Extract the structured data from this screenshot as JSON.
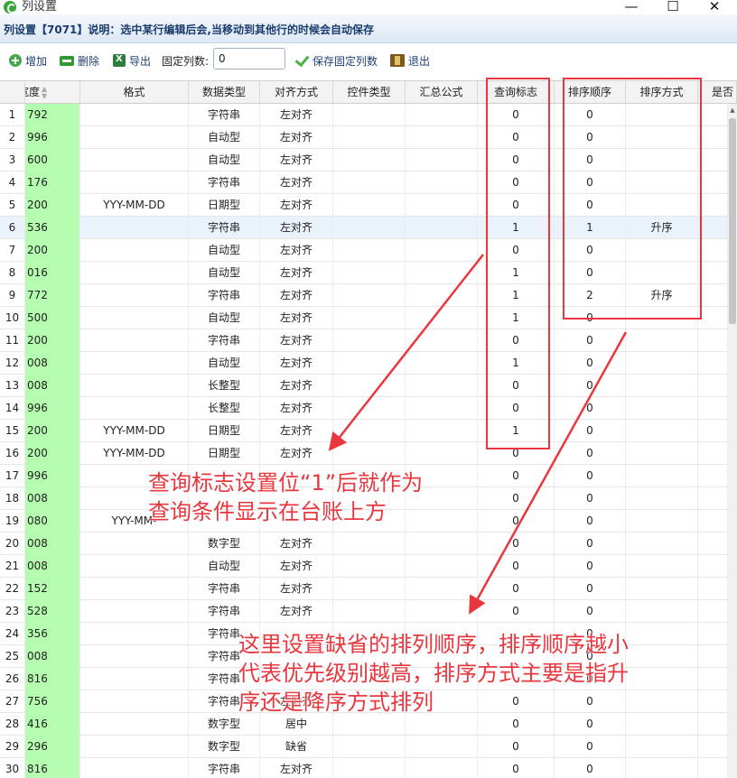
{
  "window": {
    "title": "列设置",
    "controls": [
      "—",
      "☐",
      "✕"
    ]
  },
  "header": {
    "text": "列设置【7071】说明：选中某行编辑后会,当移动到其他行的时候会自动保存"
  },
  "toolbar": {
    "add_label": "增加",
    "delete_label": "删除",
    "export_label": "导出",
    "fixed_cols_label": "固定列数:",
    "fixed_cols_value": "0",
    "save_fixed_label": "保存固定列数",
    "exit_label": "退出"
  },
  "grid": {
    "columns": [
      "宽度",
      "格式",
      "数据类型",
      "对齐方式",
      "控件类型",
      "汇总公式",
      "查询标志",
      "排序顺序",
      "排序方式",
      "是否"
    ],
    "rows": [
      {
        "n": "1",
        "w": "792",
        "fmt": "",
        "type": "字符串",
        "align": "左对齐",
        "q": "0",
        "so": "0",
        "sm": ""
      },
      {
        "n": "2",
        "w": "996",
        "fmt": "",
        "type": "自动型",
        "align": "左对齐",
        "q": "0",
        "so": "0",
        "sm": ""
      },
      {
        "n": "3",
        "w": "600",
        "fmt": "",
        "type": "自动型",
        "align": "左对齐",
        "q": "0",
        "so": "0",
        "sm": ""
      },
      {
        "n": "4",
        "w": "176",
        "fmt": "",
        "type": "字符串",
        "align": "左对齐",
        "q": "0",
        "so": "0",
        "sm": ""
      },
      {
        "n": "5",
        "w": "200",
        "fmt": "YYY-MM-DD",
        "type": "日期型",
        "align": "左对齐",
        "q": "0",
        "so": "0",
        "sm": ""
      },
      {
        "n": "6",
        "w": "536",
        "fmt": "",
        "type": "字符串",
        "align": "左对齐",
        "q": "1",
        "so": "1",
        "sm": "升序"
      },
      {
        "n": "7",
        "w": "200",
        "fmt": "",
        "type": "自动型",
        "align": "左对齐",
        "q": "0",
        "so": "0",
        "sm": ""
      },
      {
        "n": "8",
        "w": "016",
        "fmt": "",
        "type": "自动型",
        "align": "左对齐",
        "q": "1",
        "so": "0",
        "sm": ""
      },
      {
        "n": "9",
        "w": "772",
        "fmt": "",
        "type": "字符串",
        "align": "左对齐",
        "q": "1",
        "so": "2",
        "sm": "升序"
      },
      {
        "n": "10",
        "w": "500",
        "fmt": "",
        "type": "自动型",
        "align": "左对齐",
        "q": "1",
        "so": "0",
        "sm": ""
      },
      {
        "n": "11",
        "w": "200",
        "fmt": "",
        "type": "字符串",
        "align": "左对齐",
        "q": "0",
        "so": "0",
        "sm": ""
      },
      {
        "n": "12",
        "w": "008",
        "fmt": "",
        "type": "自动型",
        "align": "左对齐",
        "q": "1",
        "so": "0",
        "sm": ""
      },
      {
        "n": "13",
        "w": "008",
        "fmt": "",
        "type": "长整型",
        "align": "左对齐",
        "q": "0",
        "so": "0",
        "sm": ""
      },
      {
        "n": "14",
        "w": "996",
        "fmt": "",
        "type": "长整型",
        "align": "左对齐",
        "q": "0",
        "so": "0",
        "sm": ""
      },
      {
        "n": "15",
        "w": "200",
        "fmt": "YYY-MM-DD",
        "type": "日期型",
        "align": "左对齐",
        "q": "1",
        "so": "0",
        "sm": ""
      },
      {
        "n": "16",
        "w": "200",
        "fmt": "YYY-MM-DD",
        "type": "日期型",
        "align": "左对齐",
        "q": "0",
        "so": "0",
        "sm": ""
      },
      {
        "n": "17",
        "w": "996",
        "fmt": "",
        "type": "",
        "align": "",
        "q": "0",
        "so": "0",
        "sm": ""
      },
      {
        "n": "18",
        "w": "008",
        "fmt": "",
        "type": "",
        "align": "",
        "q": "0",
        "so": "0",
        "sm": ""
      },
      {
        "n": "19",
        "w": "080",
        "fmt": "YYY-MM-",
        "type": "",
        "align": "",
        "q": "0",
        "so": "0",
        "sm": ""
      },
      {
        "n": "20",
        "w": "008",
        "fmt": "",
        "type": "数字型",
        "align": "左对齐",
        "q": "0",
        "so": "0",
        "sm": ""
      },
      {
        "n": "21",
        "w": "008",
        "fmt": "",
        "type": "自动型",
        "align": "左对齐",
        "q": "0",
        "so": "0",
        "sm": ""
      },
      {
        "n": "22",
        "w": "152",
        "fmt": "",
        "type": "字符串",
        "align": "左对齐",
        "q": "0",
        "so": "0",
        "sm": ""
      },
      {
        "n": "23",
        "w": "528",
        "fmt": "",
        "type": "字符串",
        "align": "左对齐",
        "q": "0",
        "so": "0",
        "sm": ""
      },
      {
        "n": "24",
        "w": "356",
        "fmt": "",
        "type": "字符串",
        "align": "",
        "q": "",
        "so": "0",
        "sm": ""
      },
      {
        "n": "25",
        "w": "008",
        "fmt": "",
        "type": "字符串",
        "align": "",
        "q": "",
        "so": "0",
        "sm": ""
      },
      {
        "n": "26",
        "w": "816",
        "fmt": "",
        "type": "字符串",
        "align": "",
        "q": "",
        "so": "0",
        "sm": ""
      },
      {
        "n": "27",
        "w": "756",
        "fmt": "",
        "type": "字符串",
        "align": "左对齐",
        "q": "0",
        "so": "0",
        "sm": ""
      },
      {
        "n": "28",
        "w": "416",
        "fmt": "",
        "type": "数字型",
        "align": "居中",
        "q": "0",
        "so": "0",
        "sm": ""
      },
      {
        "n": "29",
        "w": "296",
        "fmt": "",
        "type": "数字型",
        "align": "缺省",
        "q": "0",
        "so": "0",
        "sm": ""
      },
      {
        "n": "30",
        "w": "816",
        "fmt": "",
        "type": "字符串",
        "align": "左对齐",
        "q": "0",
        "so": "0",
        "sm": ""
      }
    ]
  },
  "annotations": {
    "query_note_line1": "查询标志设置位“1”后就作为",
    "query_note_line2": "查询条件显示在台账上方",
    "sort_note_line1": "这里设置缺省的排列顺序，排序顺序越小",
    "sort_note_line2": "代表优先级别越高，排序方式主要是指升",
    "sort_note_line3": "序还是降序方式排列"
  },
  "colors": {
    "accent_red": "#e8373e",
    "width_column_bg": "#b5fbb0",
    "selected_row_bg": "#eaf2fc",
    "header_text": "#1a3c6e"
  }
}
